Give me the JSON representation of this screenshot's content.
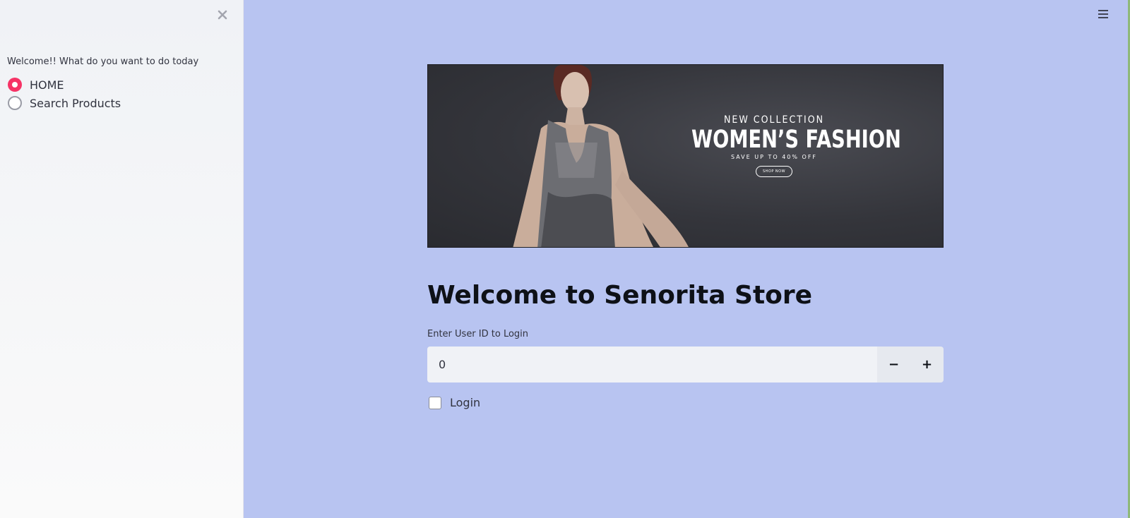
{
  "sidebar": {
    "close_icon": "close-icon",
    "prompt": "Welcome!! What do you want to do today",
    "options": [
      {
        "label": "HOME",
        "selected": true
      },
      {
        "label": "Search Products",
        "selected": false
      }
    ]
  },
  "header": {
    "menu_icon": "hamburger-menu-icon"
  },
  "banner": {
    "subtitle": "NEW COLLECTION",
    "title": "WOMEN’S FASHION",
    "tagline": "SAVE UP TO 40% OFF",
    "button": "SHOP NOW"
  },
  "main": {
    "title": "Welcome to Senorita Store",
    "user_id_label": "Enter User ID to Login",
    "user_id_value": "0",
    "decrement_label": "−",
    "increment_label": "+",
    "login_checkbox_label": "Login",
    "login_checked": false
  },
  "colors": {
    "main_bg": "#b8c4f1",
    "accent": "#f63366",
    "sidebar_bg": "#f0f2f6"
  }
}
